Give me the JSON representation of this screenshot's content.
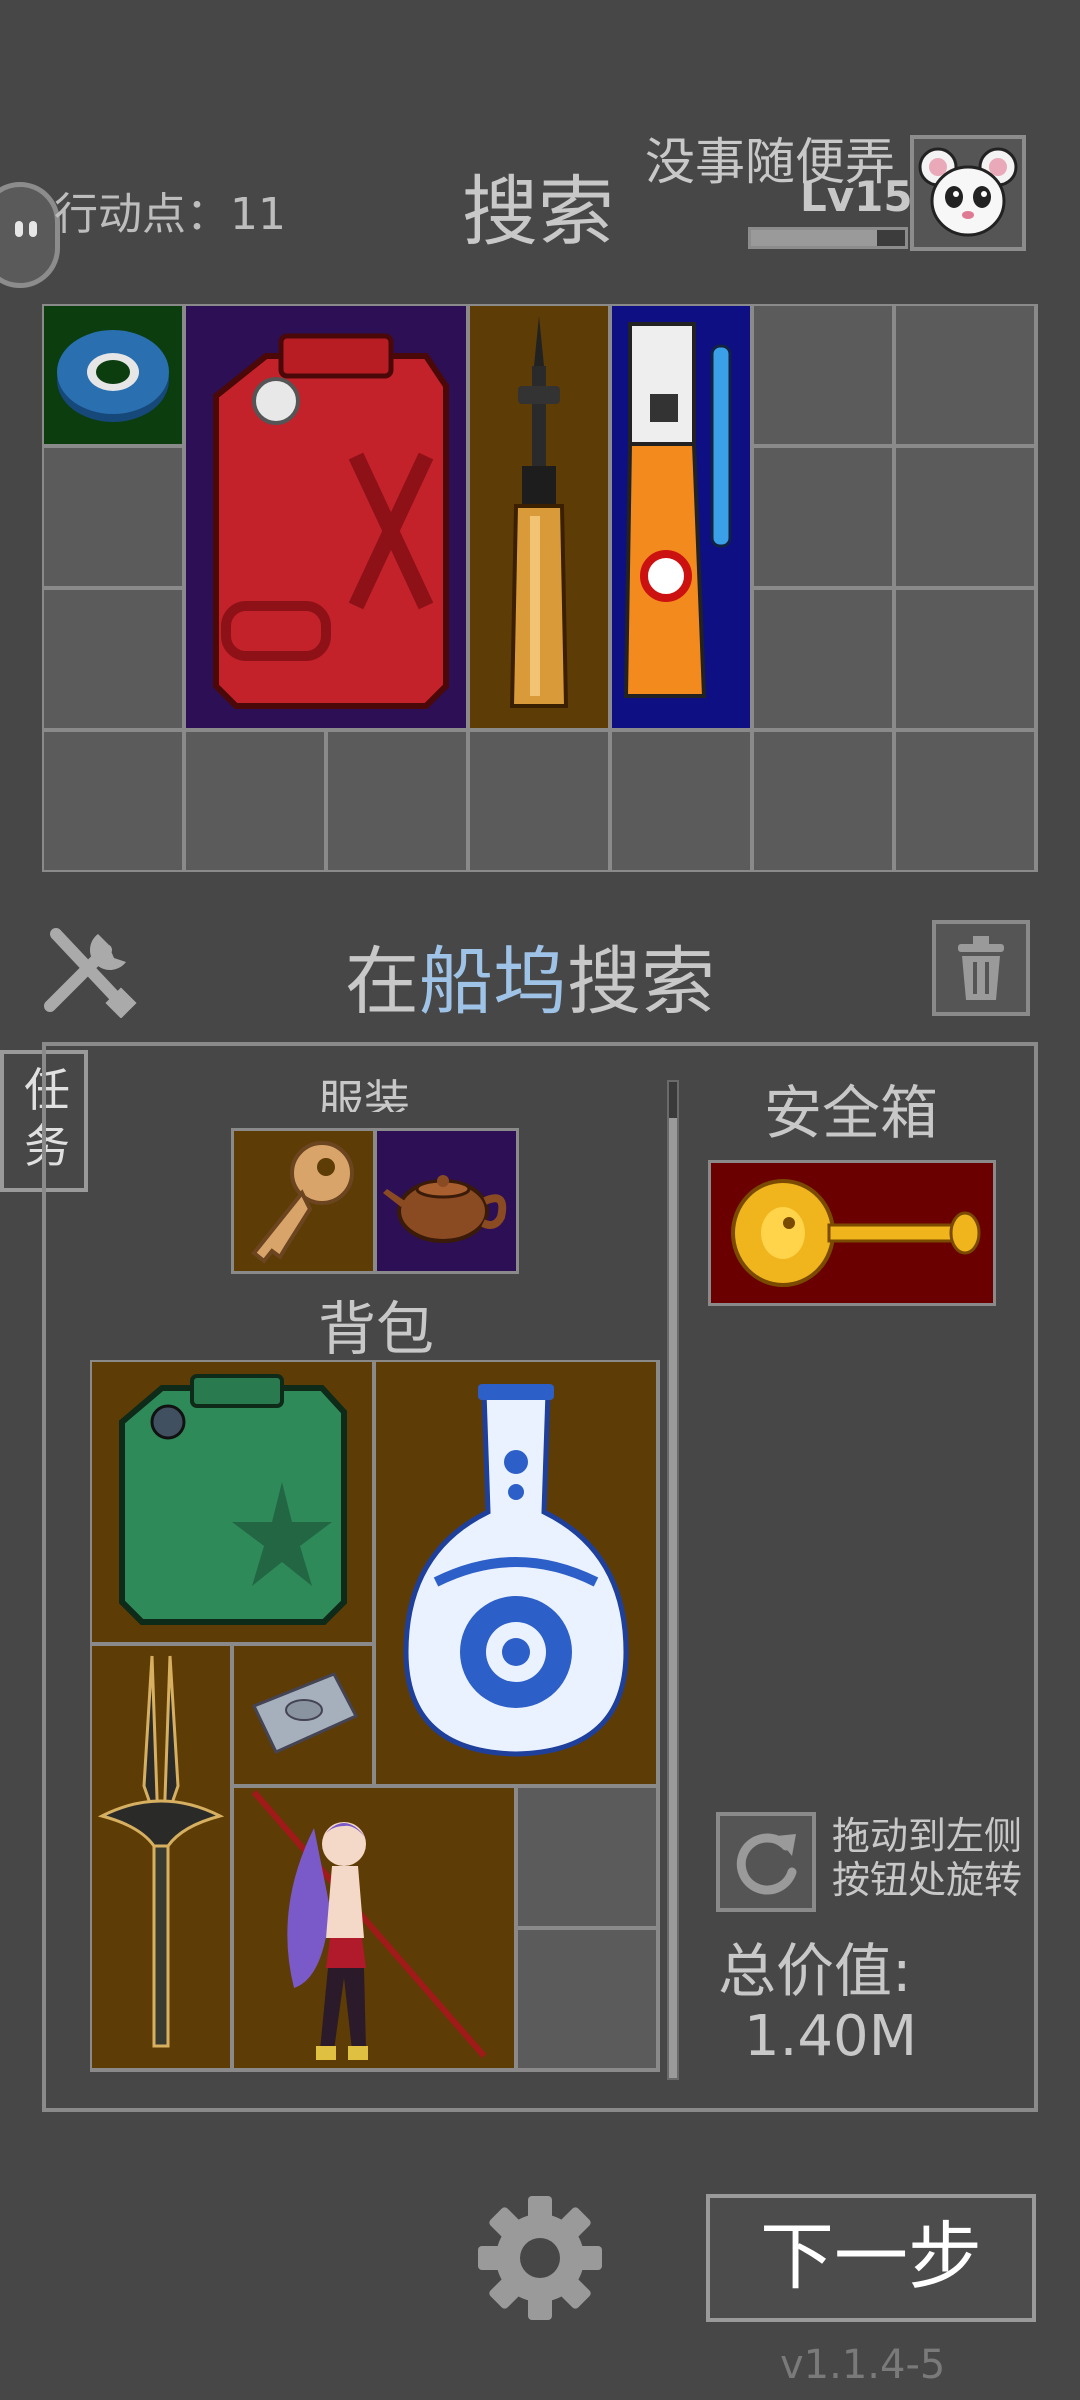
{
  "header": {
    "action_points_label": "行动点：11",
    "title": "搜索",
    "player_name": "没事随便弄",
    "level": "Lv15",
    "xp_progress": 0.82
  },
  "search_panel": {
    "title_prefix": "在",
    "location": "船坞",
    "title_suffix": "搜索",
    "location_color": "#9fc3e6"
  },
  "tabs": {
    "task_label": "任务"
  },
  "inventory": {
    "equipment_label": "服装",
    "backpack_label": "背包",
    "safe_box_label": "安全箱",
    "rotate_hint": "拖动到左侧\n按钮处旋转",
    "total_value_label": "总价值:",
    "total_value": "1.40M"
  },
  "footer": {
    "next_button": "下一步",
    "version": "v1.1.4-5"
  },
  "items": {
    "search_grid": [
      "tape-roll",
      "red-jerrycan",
      "screwdriver",
      "sealant-tube"
    ],
    "equipment": [
      "key",
      "teapot"
    ],
    "safe_box": [
      "gold-key"
    ],
    "backpack": [
      "green-jerrycan",
      "porcelain-vase",
      "dagger",
      "hard-drive",
      "anime-figure"
    ]
  },
  "colors": {
    "background": "#474747",
    "accent_blue": "#9fc3e6",
    "slot_brown": "#5e3c05",
    "slot_purple": "#2d0f55",
    "slot_red": "#6a0000"
  }
}
